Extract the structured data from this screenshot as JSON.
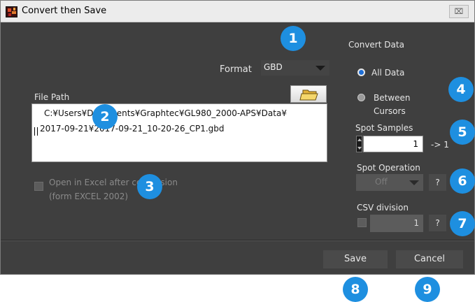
{
  "window": {
    "title": "Convert then Save",
    "close_glyph": "⌧"
  },
  "format": {
    "label": "Format",
    "value": "GBD"
  },
  "file_path": {
    "label": "File Path",
    "line1": "C:¥Users¥Documents¥Graphtec¥GL980_2000-APS¥Data¥",
    "line2": "2017-09-21¥2017-09-21_10-20-26_CP1.gbd"
  },
  "open_excel": {
    "line1": "Open in Excel after conversion",
    "line2": "(form EXCEL 2002)"
  },
  "convert_data": {
    "heading": "Convert Data",
    "option_all": "All Data",
    "option_between_1": "Between",
    "option_between_2": "Cursors"
  },
  "spot_samples": {
    "label": "Spot Samples",
    "value": "1",
    "suffix": "-> 1"
  },
  "spot_operation": {
    "label": "Spot Operation",
    "value": "Off",
    "help": "?"
  },
  "csv_division": {
    "label": "CSV division",
    "value": "1",
    "help": "?"
  },
  "footer": {
    "save": "Save",
    "cancel": "Cancel"
  },
  "badges": [
    "1",
    "2",
    "3",
    "4",
    "5",
    "6",
    "7",
    "8",
    "9"
  ],
  "colors": {
    "badge": "#1e8fe0",
    "dialog_bg": "#3f3f3f",
    "radio_selected": "#1e6ed6"
  }
}
